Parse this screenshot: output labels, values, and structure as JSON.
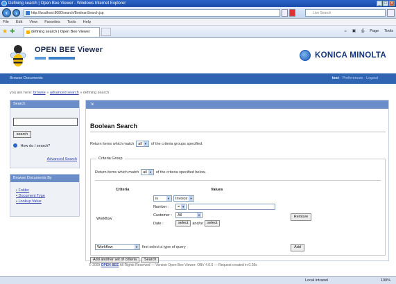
{
  "window": {
    "title": "Defining search | Open Bee Viewer - Windows Internet Explorer",
    "buttons": [
      "_",
      "□",
      "✕"
    ]
  },
  "address_bar": {
    "url": "http://localhost:8080/search/BooleanSearch.jsp",
    "search_placeholder": "Live Search"
  },
  "menu": [
    "File",
    "Edit",
    "View",
    "Favorites",
    "Tools",
    "Help"
  ],
  "tab": {
    "label": "defining search | Open Bee Viewer"
  },
  "toolbar": [
    "Page",
    "Tools"
  ],
  "app": {
    "product": "OPEN BEE Viewer",
    "vendor": "KONICA MINOLTA"
  },
  "bluebar": {
    "left": "Browse Documents",
    "user": "test",
    "preferences": "Preferences",
    "logout": "Logout"
  },
  "breadcrumb": {
    "prefix": "you are here:",
    "browse": "browse",
    "advanced": "advanced search",
    "current": "defining search"
  },
  "search_panel": {
    "heading": "Search",
    "input_value": "",
    "button": "search",
    "help": "How do I search?",
    "advanced_link": "Advanced Search"
  },
  "browse_panel": {
    "heading": "Browse Documents By",
    "items": [
      "Folder",
      "Document Type",
      "Lookup Value"
    ]
  },
  "main": {
    "heading": "",
    "title": "Boolean Search",
    "match_prefix": "Return items which match",
    "match_value": "all",
    "match_suffix": "of the criteria groups specified.",
    "group": {
      "legend": "Criteria Group",
      "match_prefix": "Return items which match",
      "match_value": "all",
      "match_suffix": "of the criteria specified below.",
      "col_criteria": "Criteria",
      "col_values": "Values",
      "workflow_label": "Workflow",
      "row1": {
        "op": "is",
        "value": "Invoice"
      },
      "row2": {
        "label": "Number :",
        "op": "=",
        "value": ""
      },
      "row3": {
        "label": "Customer :",
        "value": "All"
      },
      "row4": {
        "label": "Date :",
        "select1": "select",
        "andor": "and/or",
        "select2": "select"
      },
      "remove": "Remove",
      "type_select": "Workflow",
      "type_hint": "first select a type of query",
      "add": "Add"
    },
    "add_set": "Add another set of criteria",
    "search": "Search"
  },
  "footer": {
    "copyright": "© 2009",
    "brand": "OPEN BEE",
    "rest": "All Rights Reserved — Version Open Bee Viewer: OBV 4.0.0 — Request created in 0.28s"
  },
  "statusbar": {
    "zone": "Local intranet",
    "zoom": "100%"
  }
}
